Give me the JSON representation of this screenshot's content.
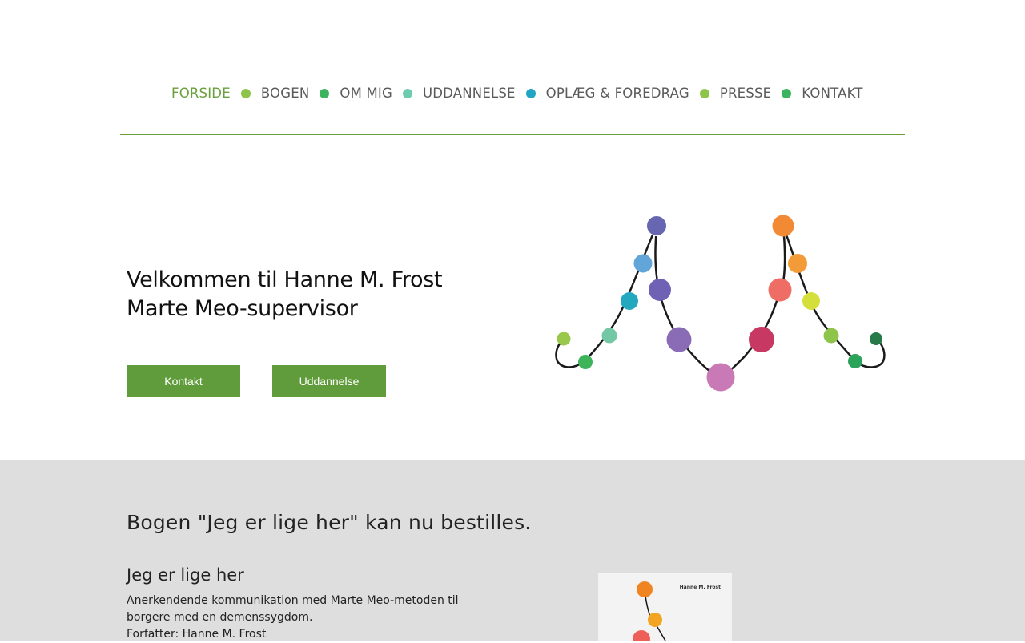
{
  "nav": {
    "items": [
      {
        "label": "FORSIDE",
        "active": true,
        "dot_color": "#8fc44a"
      },
      {
        "label": "BOGEN",
        "active": false,
        "dot_color": "#3cb35d"
      },
      {
        "label": "OM MIG",
        "active": false,
        "dot_color": "#6dcbb0"
      },
      {
        "label": "UDDANNELSE",
        "active": false,
        "dot_color": "#22a5c4"
      },
      {
        "label": "OPLÆG & FOREDRAG",
        "active": false,
        "dot_color": "#8fc44a"
      },
      {
        "label": "PRESSE",
        "active": false,
        "dot_color": "#3cb35d"
      },
      {
        "label": "KONTAKT",
        "active": false
      }
    ]
  },
  "hero": {
    "title_line1": "Velkommen til Hanne M. Frost",
    "title_line2": "Marte Meo-supervisor",
    "buttons": {
      "contact": "Kontakt",
      "education": "Uddannelse"
    }
  },
  "book_section": {
    "headline": "Bogen \"Jeg er lige her\" kan nu bestilles.",
    "title": "Jeg er lige her",
    "description_line1": "Anerkendende kommunikation med Marte Meo-metoden til",
    "description_line2": "borgere med en demenssygdom.",
    "author_line": "Forfatter: Hanne M. Frost",
    "cover_author": "Hanne M. Frost"
  },
  "colors": {
    "accent": "#619c3c",
    "active_nav": "#6a9f3c",
    "band": "#dedede"
  }
}
